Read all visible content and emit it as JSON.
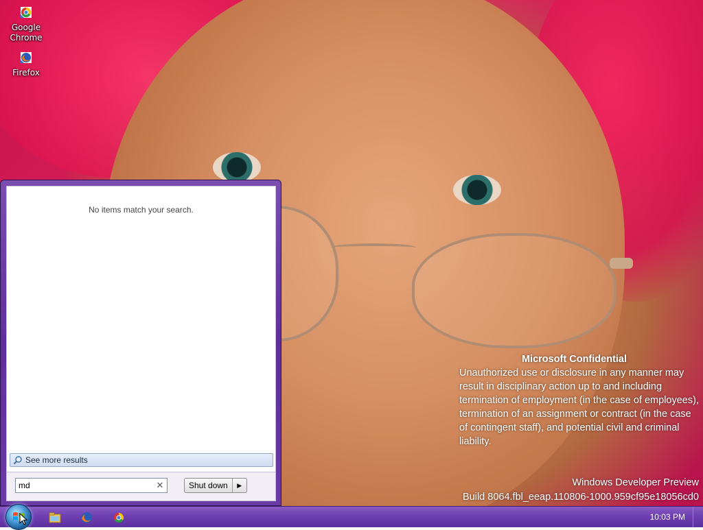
{
  "desktop": {
    "icons": [
      {
        "label": "Google Chrome",
        "icon": "chrome-icon"
      },
      {
        "label": "Firefox",
        "icon": "firefox-icon"
      }
    ],
    "confidential": {
      "title": "Microsoft Confidential",
      "body": "Unauthorized use or disclosure in any manner may result in disciplinary action up to and including termination of employment (in the case of employees), termination of an assignment or contract (in the case of contingent staff), and potential civil and criminal liability."
    },
    "build": {
      "product": "Windows Developer Preview",
      "build_string": "Build 8064.fbl_eeap.110806-1000.959cf95e18056cd0"
    }
  },
  "start_menu": {
    "no_results_text": "No items match your search.",
    "see_more_label": "See more results",
    "search": {
      "value": "md",
      "placeholder": ""
    },
    "clear_label": "✕",
    "shutdown_label": "Shut down"
  },
  "taskbar": {
    "pinned": [
      "explorer-icon",
      "firefox-icon",
      "chrome-icon"
    ],
    "clock": "10:03 PM"
  },
  "colors": {
    "taskbar": "#6d3fb0",
    "start_menu_frame": "#5e2f99",
    "see_more_bg": "#cfdcf1"
  }
}
